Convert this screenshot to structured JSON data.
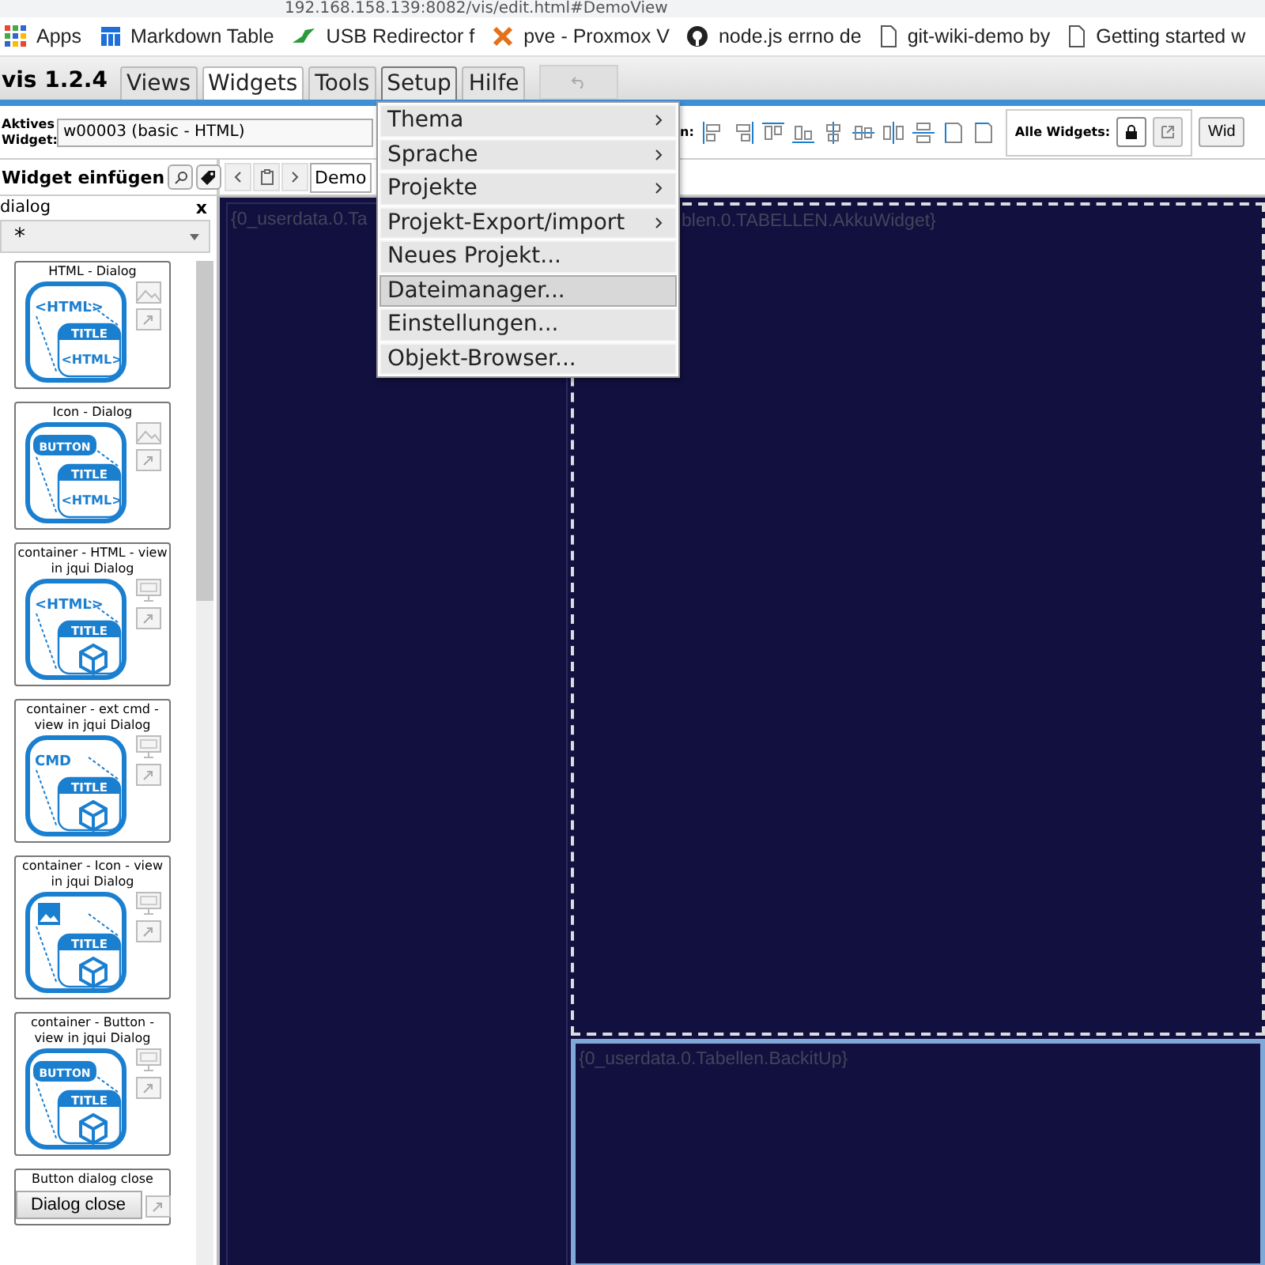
{
  "address_bar": {
    "url": "192.168.158.139:8082/vis/edit.html#DemoView"
  },
  "bookmarks": [
    {
      "label": "Apps",
      "kind": "apps"
    },
    {
      "label": "Markdown Table",
      "kind": "table"
    },
    {
      "label": "USB Redirector f",
      "kind": "plug"
    },
    {
      "label": "pve - Proxmox V",
      "kind": "cross"
    },
    {
      "label": "node.js errno de",
      "kind": "octocat"
    },
    {
      "label": "git-wiki-demo by",
      "kind": "page"
    },
    {
      "label": "Getting started w",
      "kind": "page"
    }
  ],
  "app": {
    "title": "vis 1.2.4"
  },
  "menu_tabs": [
    {
      "label": "Views",
      "selected": false,
      "open": false
    },
    {
      "label": "Widgets",
      "selected": true,
      "open": false
    },
    {
      "label": "Tools",
      "selected": false,
      "open": false
    },
    {
      "label": "Setup",
      "selected": false,
      "open": true
    },
    {
      "label": "Hilfe",
      "selected": false,
      "open": false
    }
  ],
  "toolbar": {
    "active_widget_label": "Aktives Widget:",
    "active_widget": "w00003 (basic - HTML)",
    "align_label": "n:",
    "align_tools": [
      {
        "kind": "left"
      },
      {
        "kind": "right"
      },
      {
        "kind": "top"
      },
      {
        "kind": "bottom"
      },
      {
        "kind": "center-h"
      },
      {
        "kind": "center-v"
      },
      {
        "kind": "spread-h"
      },
      {
        "kind": "spread-v"
      },
      {
        "kind": "same-w"
      },
      {
        "kind": "same-h"
      }
    ],
    "all_widgets_label": "Alle Widgets:",
    "next_button": "Wid"
  },
  "insert_panel": {
    "title": "Widget einfügen",
    "filter": "dialog",
    "clear": "x",
    "category": "*",
    "cards": [
      {
        "title": "HTML - Dialog",
        "kind": "preview",
        "badge": {
          "kind": "text",
          "text": "<HTML>"
        },
        "header": "TITLE",
        "body": {
          "kind": "text",
          "text": "<HTML>"
        },
        "side_icons": [
          {
            "kind": "image"
          },
          {
            "kind": "link"
          }
        ]
      },
      {
        "title": "Icon - Dialog",
        "kind": "preview",
        "badge": {
          "kind": "pill",
          "text": "BUTTON"
        },
        "header": "TITLE",
        "body": {
          "kind": "text",
          "text": "<HTML>"
        },
        "side_icons": [
          {
            "kind": "image"
          },
          {
            "kind": "link"
          }
        ]
      },
      {
        "title": "container - HTML - view in jqui Dialog",
        "kind": "preview",
        "badge": {
          "kind": "text",
          "text": "<HTML>"
        },
        "header": "TITLE",
        "body": {
          "kind": "cube"
        },
        "side_icons": [
          {
            "kind": "monitor"
          },
          {
            "kind": "link"
          }
        ]
      },
      {
        "title": "container - ext cmd - view in jqui Dialog",
        "kind": "preview",
        "badge": {
          "kind": "text",
          "text": "CMD"
        },
        "header": "TITLE",
        "body": {
          "kind": "cube"
        },
        "side_icons": [
          {
            "kind": "monitor"
          },
          {
            "kind": "link"
          }
        ]
      },
      {
        "title": "container - Icon - view in jqui Dialog",
        "kind": "preview",
        "badge": {
          "kind": "image"
        },
        "header": "TITLE",
        "body": {
          "kind": "cube"
        },
        "side_icons": [
          {
            "kind": "monitor"
          },
          {
            "kind": "link"
          }
        ]
      },
      {
        "title": "container - Button - view in jqui Dialog",
        "kind": "preview",
        "badge": {
          "kind": "pill",
          "text": "BUTTON"
        },
        "header": "TITLE",
        "body": {
          "kind": "cube"
        },
        "side_icons": [
          {
            "kind": "monitor"
          },
          {
            "kind": "link"
          }
        ]
      },
      {
        "title": "Button dialog close",
        "kind": "button",
        "button": "Dialog close",
        "side_icons": [
          {
            "kind": "link"
          }
        ]
      }
    ]
  },
  "view_nav": {
    "view": "Demo"
  },
  "canvas": {
    "widgets": [
      {
        "text": "{0_userdata.0.Ta",
        "kind": "plain"
      },
      {
        "text": "blen.0.TABELLEN.AkkuWidget}",
        "kind": "selected"
      },
      {
        "text": "{0_userdata.0.Tabellen.BackitUp}",
        "kind": "framed"
      }
    ]
  },
  "dropdown": {
    "items": [
      {
        "label": "Thema",
        "submenu": true,
        "highlighted": false
      },
      {
        "label": "Sprache",
        "submenu": true,
        "highlighted": false
      },
      {
        "label": "Projekte",
        "submenu": true,
        "highlighted": false
      },
      {
        "label": "Projekt-Export/import",
        "submenu": true,
        "highlighted": false
      },
      {
        "label": "Neues Projekt...",
        "submenu": false,
        "highlighted": false
      },
      {
        "label": "Dateimanager...",
        "submenu": false,
        "highlighted": true
      },
      {
        "label": "Einstellungen...",
        "submenu": false,
        "highlighted": false
      },
      {
        "label": "Objekt-Browser...",
        "submenu": false,
        "highlighted": false
      }
    ]
  }
}
